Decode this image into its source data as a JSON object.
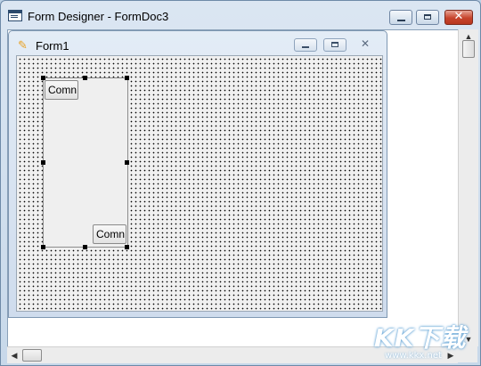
{
  "window": {
    "title": "Form Designer - FormDoc3",
    "icon": "form-designer-icon",
    "buttons": {
      "minimize": "minimize-icon",
      "maximize": "maximize-icon",
      "close": "close-icon"
    }
  },
  "child_form": {
    "title": "Form1",
    "icon": "form-icon",
    "buttons": {
      "minimize": "minimize-icon",
      "maximize": "maximize-icon",
      "close": "close-icon"
    }
  },
  "controls": {
    "command_top": "Comn",
    "command_bottom": "Comn"
  },
  "watermark": {
    "main": "KK下载",
    "sub": "www.kkx.net"
  },
  "colors": {
    "close_button": "#c7442c",
    "title_gradient": "#dbe6f2"
  }
}
